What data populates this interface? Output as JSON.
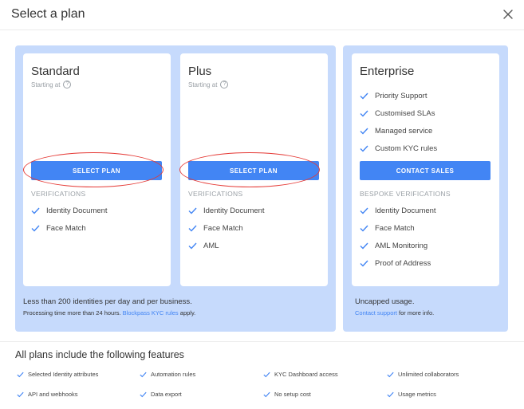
{
  "modal": {
    "title": "Select a plan",
    "close_icon": "close-icon"
  },
  "plans": [
    {
      "name": "Standard",
      "starting_at": "Starting at",
      "button": "SELECT PLAN",
      "section": "VERIFICATIONS",
      "features": [
        "Identity Document",
        "Face Match"
      ]
    },
    {
      "name": "Plus",
      "starting_at": "Starting at",
      "button": "SELECT PLAN",
      "section": "VERIFICATIONS",
      "features": [
        "Identity Document",
        "Face Match",
        "AML"
      ]
    }
  ],
  "enterprise": {
    "name": "Enterprise",
    "perks": [
      "Priority Support",
      "Customised SLAs",
      "Managed service",
      "Custom KYC rules"
    ],
    "button": "CONTACT SALES",
    "section": "BESPOKE VERIFICATIONS",
    "features": [
      "Identity Document",
      "Face Match",
      "AML Monitoring",
      "Proof of Address"
    ]
  },
  "standard_group": {
    "note": "Less than 200 identities per day and per business.",
    "sub_prefix": "Processing time more than 24 hours. ",
    "sub_link": "Blockpass KYC rules",
    "sub_suffix": " apply."
  },
  "enterprise_group": {
    "note": "Uncapped usage.",
    "sub_link": "Contact support",
    "sub_suffix": " for more info."
  },
  "included": {
    "title": "All plans include the following features",
    "items": [
      "Selected Identity attributes",
      "Automation rules",
      "KYC Dashboard access",
      "Unlimited collaborators",
      "API and webhooks",
      "Data export",
      "No setup cost",
      "Usage metrics"
    ]
  },
  "colors": {
    "accent": "#4285f4",
    "group_bg": "#c6dafc",
    "highlight": "#e53935"
  }
}
